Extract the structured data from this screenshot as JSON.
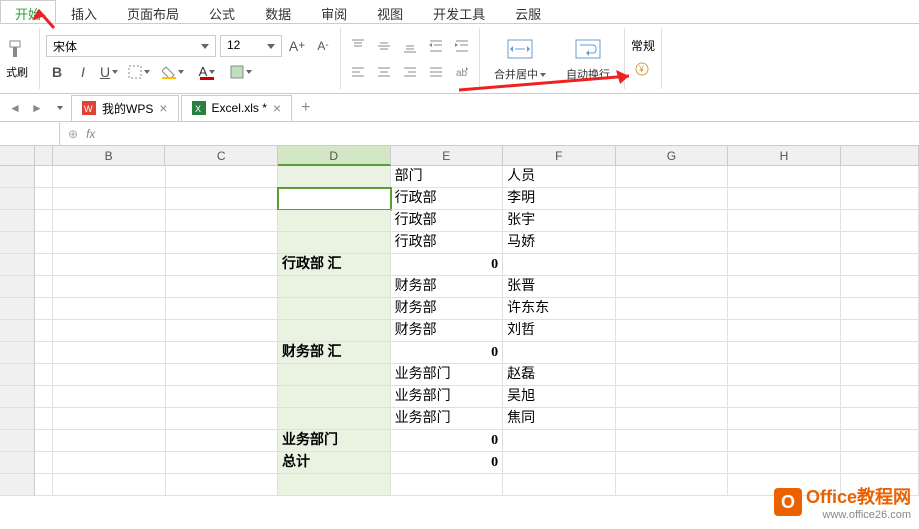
{
  "menu": {
    "tabs": [
      "开始",
      "插入",
      "页面布局",
      "公式",
      "数据",
      "审阅",
      "视图",
      "开发工具",
      "云服"
    ]
  },
  "font": {
    "name": "宋体",
    "size": "12"
  },
  "ribbon": {
    "merge_label": "合并居中",
    "wrap_label": "自动换行",
    "style_label": "常规"
  },
  "tabs": {
    "wps": {
      "label": "我的WPS"
    },
    "excel": {
      "label": "Excel.xls *"
    }
  },
  "formula": {
    "fx": "fx"
  },
  "columns": [
    "B",
    "C",
    "D",
    "E",
    "F",
    "G",
    "H"
  ],
  "rows": [
    {
      "D": "",
      "E": "部门",
      "F": "人员"
    },
    {
      "D": "",
      "E": "行政部",
      "F": "李明",
      "active": true
    },
    {
      "D": "",
      "E": "行政部",
      "F": "张宇"
    },
    {
      "D": "",
      "E": "行政部",
      "F": "马娇"
    },
    {
      "D": "行政部  汇",
      "E": "0",
      "F": "",
      "bold": true,
      "right_e": true
    },
    {
      "D": "",
      "E": "财务部",
      "F": "张晋"
    },
    {
      "D": "",
      "E": "财务部",
      "F": "许东东"
    },
    {
      "D": "",
      "E": "财务部",
      "F": "刘哲"
    },
    {
      "D": "财务部  汇",
      "E": "0",
      "F": "",
      "bold": true,
      "right_e": true
    },
    {
      "D": "",
      "E": "业务部门",
      "F": "赵磊"
    },
    {
      "D": "",
      "E": "业务部门",
      "F": "吴旭"
    },
    {
      "D": "",
      "E": "业务部门",
      "F": "焦同"
    },
    {
      "D": "业务部门",
      "E": "0",
      "F": "",
      "bold": true,
      "right_e": true
    },
    {
      "D": "总计",
      "E": "0",
      "F": "",
      "bold": true,
      "right_e": true
    },
    {
      "D": "",
      "E": "",
      "F": ""
    }
  ],
  "watermark": {
    "text": "Office教程网",
    "url": "www.office26.com"
  }
}
